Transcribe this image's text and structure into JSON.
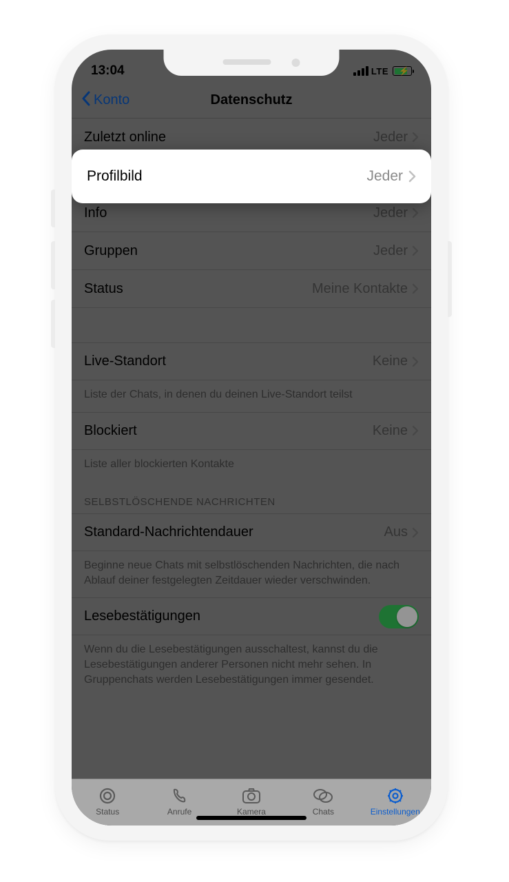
{
  "status": {
    "time": "13:04",
    "network": "LTE"
  },
  "nav": {
    "back": "Konto",
    "title": "Datenschutz"
  },
  "sections": {
    "last_seen": {
      "label": "Zuletzt online",
      "value": "Jeder"
    },
    "profile_pic": {
      "label": "Profilbild",
      "value": "Jeder"
    },
    "about": {
      "label": "Info",
      "value": "Jeder"
    },
    "groups": {
      "label": "Gruppen",
      "value": "Jeder"
    },
    "status": {
      "label": "Status",
      "value": "Meine Kontakte"
    },
    "live_loc": {
      "label": "Live-Standort",
      "value": "Keine"
    },
    "live_loc_note": "Liste der Chats, in denen du deinen Live-Standort teilst",
    "blocked": {
      "label": "Blockiert",
      "value": "Keine"
    },
    "blocked_note": "Liste aller blockierten Kontakte",
    "disappearing_header": "SELBSTLÖSCHENDE NACHRICHTEN",
    "default_timer": {
      "label": "Standard-Nachrichtendauer",
      "value": "Aus"
    },
    "default_timer_note": "Beginne neue Chats mit selbstlöschenden Nachrichten, die nach Ablauf deiner festgelegten Zeitdauer wieder verschwinden.",
    "read_receipts": {
      "label": "Lesebestätigungen"
    },
    "read_receipts_note": "Wenn du die Lesebestätigungen ausschaltest, kannst du die Lesebestätigungen anderer Personen nicht mehr sehen. In Gruppenchats werden Lesebestätigungen immer gesendet."
  },
  "tabs": {
    "status": "Status",
    "calls": "Anrufe",
    "camera": "Kamera",
    "chats": "Chats",
    "settings": "Einstellungen"
  }
}
